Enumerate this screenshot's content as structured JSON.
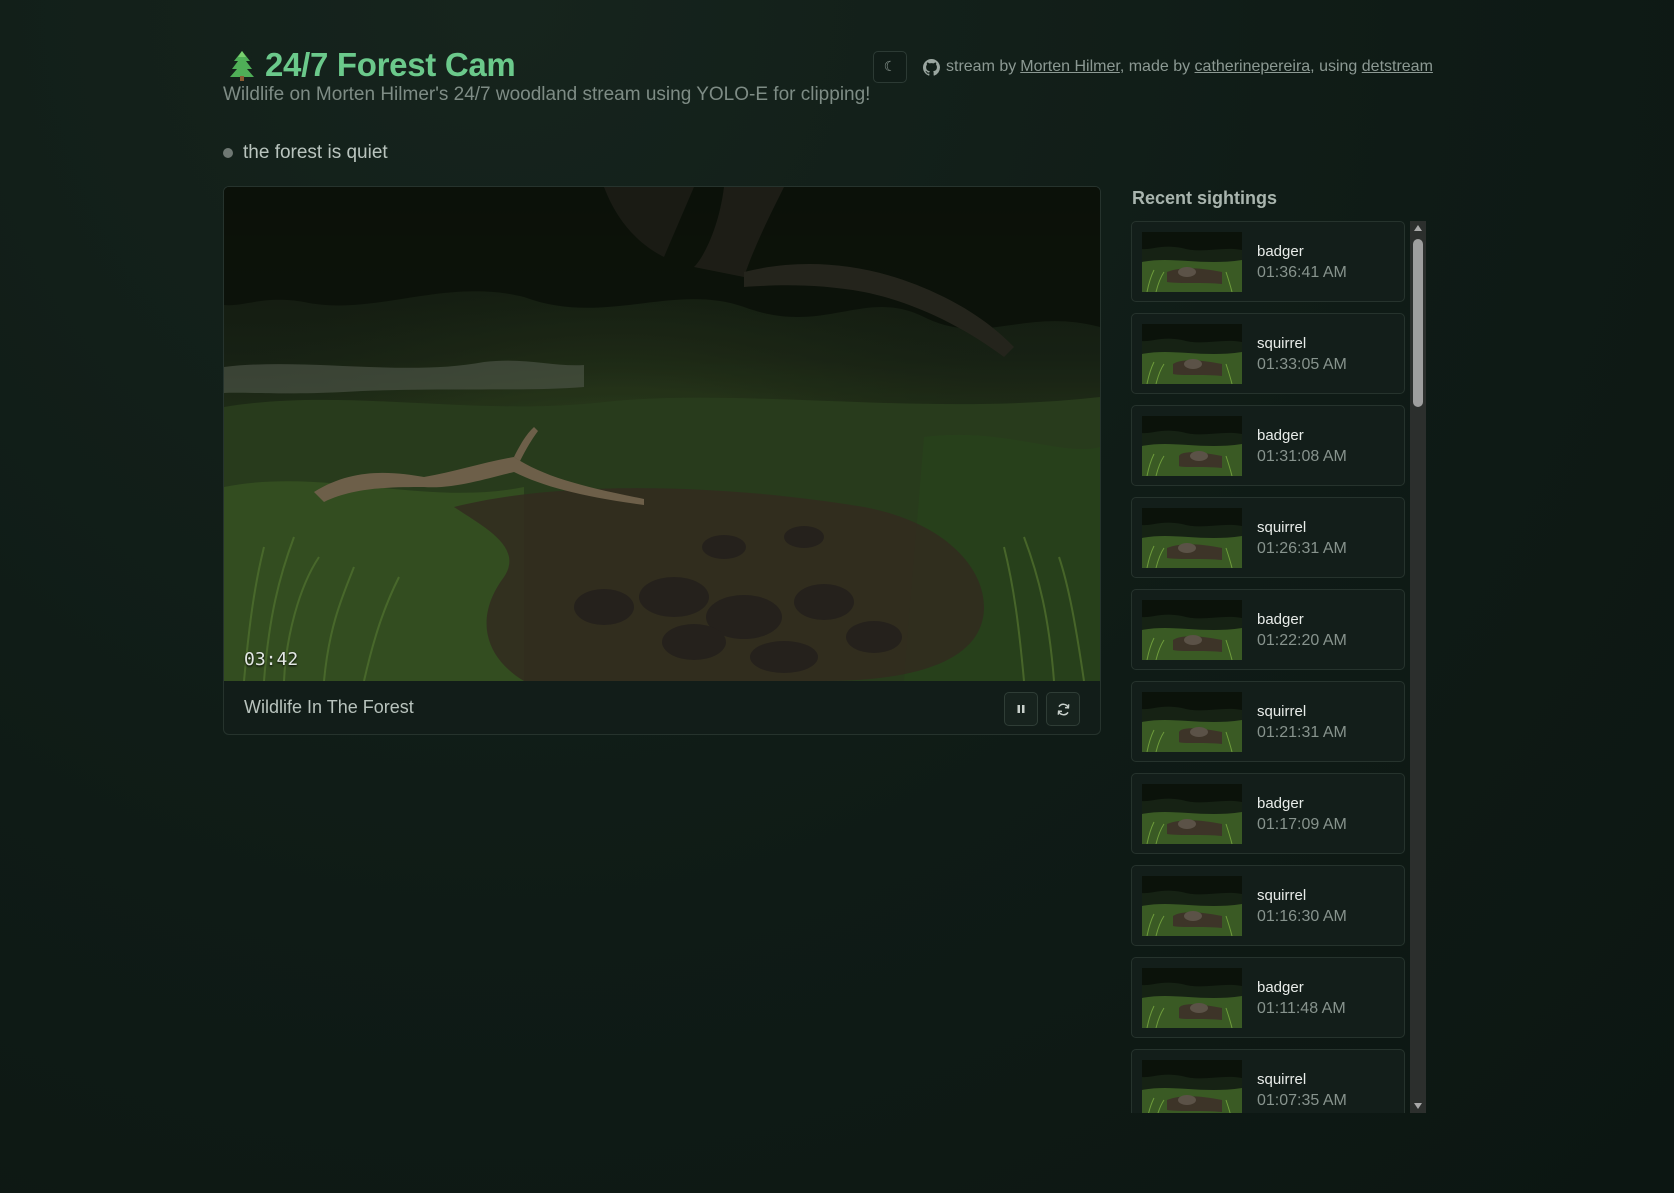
{
  "header": {
    "title": "24/7 Forest Cam",
    "subtitle": "Wildlife on Morten Hilmer's 24/7 woodland stream using YOLO-E for clipping!",
    "theme_toggle_icon": "☾",
    "credits": {
      "prefix": "stream by",
      "stream_author": "Morten Hilmer",
      "made_by_label": ", made by",
      "maker": "catherinepereira",
      "using_label": ", using",
      "tool": "detstream"
    }
  },
  "status": {
    "text": "the forest is quiet",
    "dot_color": "#6f7873"
  },
  "player": {
    "timestamp": "03:42",
    "title": "Wildlife In The Forest",
    "pause_icon": "pause-icon",
    "refresh_icon": "refresh-icon"
  },
  "sightings": {
    "title": "Recent sightings",
    "items": [
      {
        "species": "badger",
        "time": "01:36:41 AM"
      },
      {
        "species": "squirrel",
        "time": "01:33:05 AM"
      },
      {
        "species": "badger",
        "time": "01:31:08 AM"
      },
      {
        "species": "squirrel",
        "time": "01:26:31 AM"
      },
      {
        "species": "badger",
        "time": "01:22:20 AM"
      },
      {
        "species": "squirrel",
        "time": "01:21:31 AM"
      },
      {
        "species": "badger",
        "time": "01:17:09 AM"
      },
      {
        "species": "squirrel",
        "time": "01:16:30 AM"
      },
      {
        "species": "badger",
        "time": "01:11:48 AM"
      },
      {
        "species": "squirrel",
        "time": "01:07:35 AM"
      }
    ]
  },
  "colors": {
    "accent": "#6bc98b",
    "background": "#0f1b16",
    "card": "#131e1a"
  }
}
